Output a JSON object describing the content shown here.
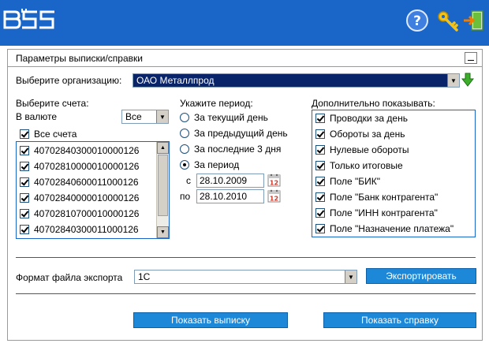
{
  "app": {
    "logo_text": "BSS",
    "icons": [
      "help-icon",
      "key-icon",
      "exit-door-icon"
    ]
  },
  "panel": {
    "title": "Параметры выписки/справки"
  },
  "organization": {
    "label": "Выберите организацию:",
    "value": "ОАО Металлпрод"
  },
  "accounts": {
    "title": "Выберите счета:",
    "currency_label": "В валюте",
    "currency_value": "Все",
    "all_label": "Все счета",
    "all_checked": true,
    "items": [
      {
        "number": "40702840300010000126",
        "checked": true
      },
      {
        "number": "40702810000010000126",
        "checked": true
      },
      {
        "number": "40702840600011000126",
        "checked": true
      },
      {
        "number": "40702840000010000126",
        "checked": true
      },
      {
        "number": "40702810700010000126",
        "checked": true
      },
      {
        "number": "40702840300011000126",
        "checked": true
      }
    ]
  },
  "period": {
    "title": "Укажите период:",
    "options": [
      "За текущий день",
      "За предыдущий день",
      "За последние 3 дня",
      "За период"
    ],
    "selected_index": 3,
    "from_label": "с",
    "from_value": "28.10.2009",
    "to_label": "по",
    "to_value": "28.10.2010",
    "calendar_day": "12"
  },
  "extra": {
    "title": "Дополнительно показывать:",
    "items": [
      {
        "label": "Проводки за день",
        "checked": true
      },
      {
        "label": "Обороты за день",
        "checked": true
      },
      {
        "label": "Нулевые обороты",
        "checked": true
      },
      {
        "label": "Только итоговые",
        "checked": true
      },
      {
        "label": "Поле \"БИК\"",
        "checked": true
      },
      {
        "label": "Поле \"Банк контрагента\"",
        "checked": true
      },
      {
        "label": "Поле \"ИНН контрагента\"",
        "checked": true
      },
      {
        "label": "Поле \"Назначение платежа\"",
        "checked": true
      }
    ]
  },
  "export": {
    "label": "Формат файла экспорта",
    "format_value": "1С",
    "button_label": "Экспортировать"
  },
  "actions": {
    "show_statement": "Показать выписку",
    "show_certificate": "Показать справку"
  },
  "colors": {
    "header_blue": "#1a66c8",
    "button_blue": "#1e88d8",
    "selection_navy": "#0a246a"
  }
}
